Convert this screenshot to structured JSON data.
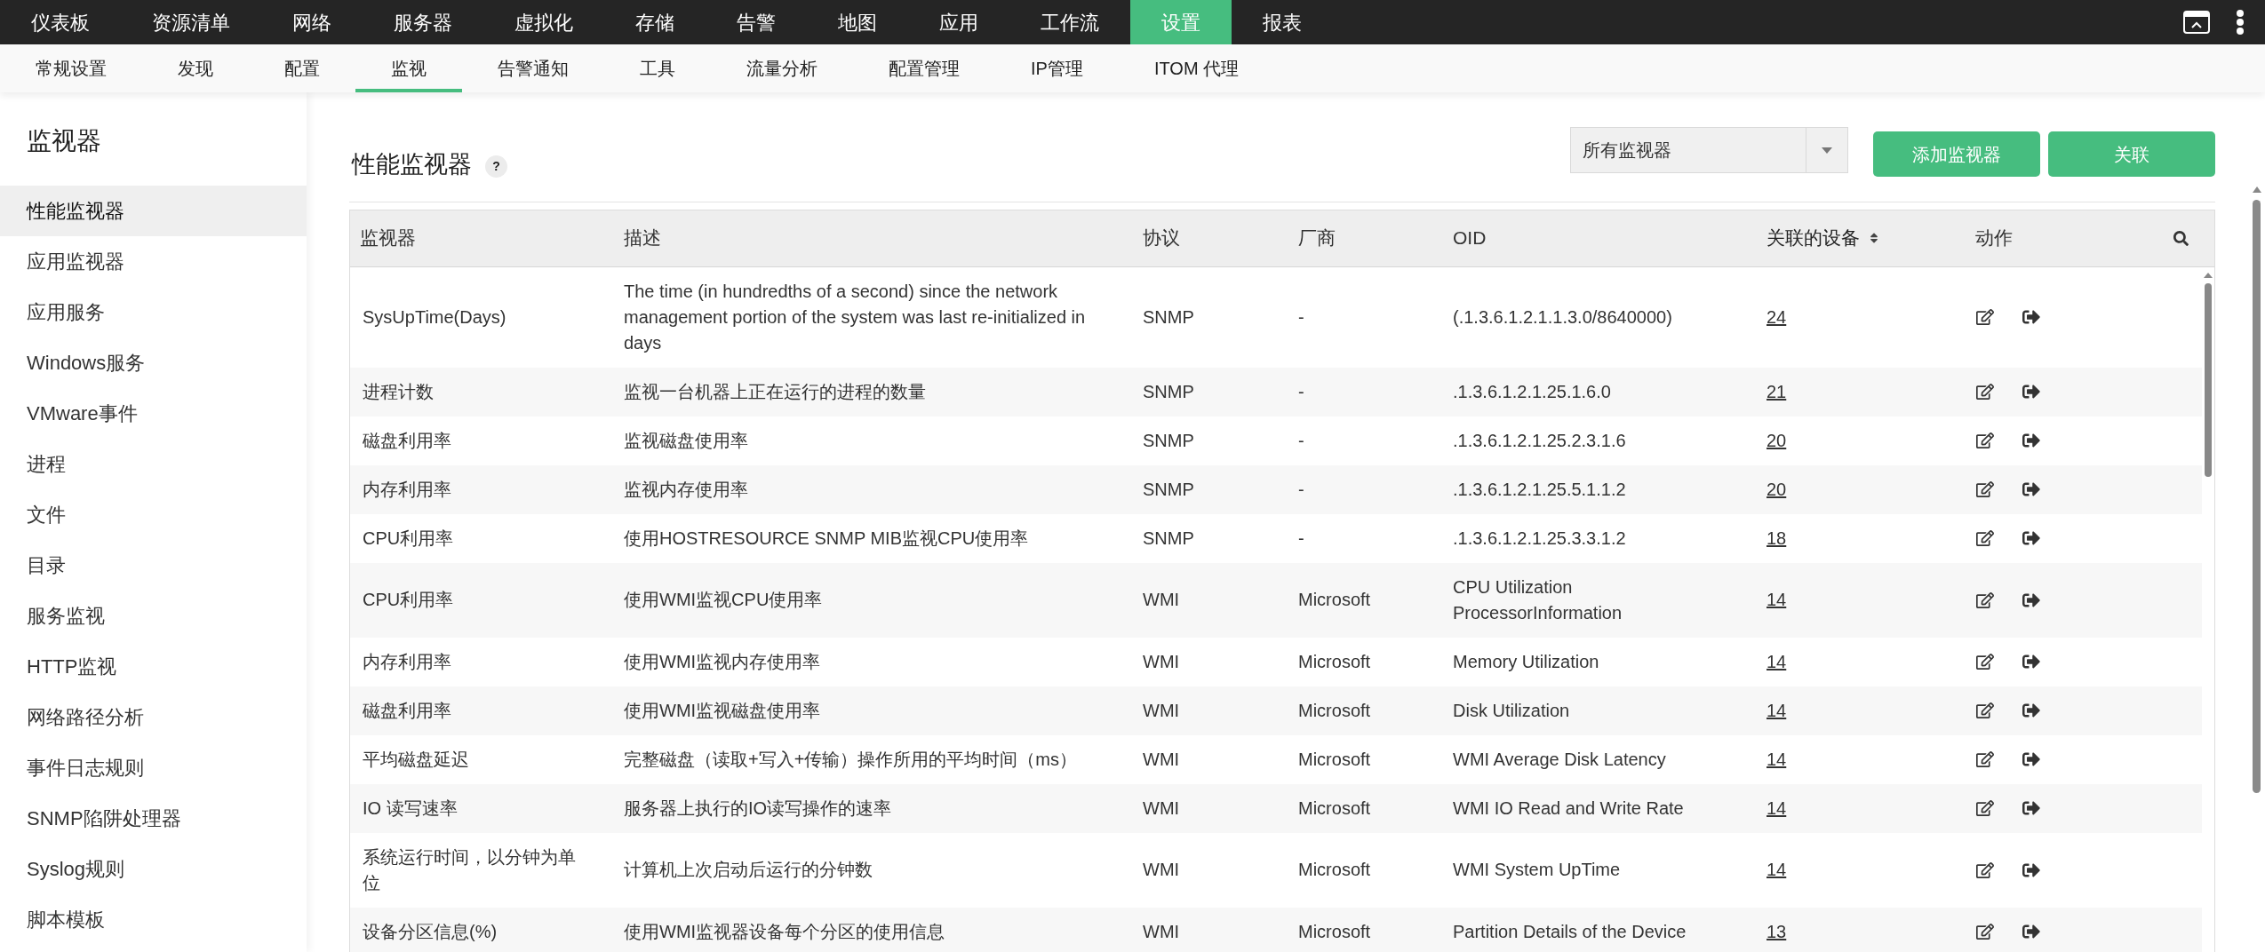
{
  "top_nav": [
    {
      "label": "仪表板",
      "selected": false
    },
    {
      "label": "资源清单",
      "selected": false
    },
    {
      "label": "网络",
      "selected": false
    },
    {
      "label": "服务器",
      "selected": false
    },
    {
      "label": "虚拟化",
      "selected": false
    },
    {
      "label": "存储",
      "selected": false
    },
    {
      "label": "告警",
      "selected": false
    },
    {
      "label": "地图",
      "selected": false
    },
    {
      "label": "应用",
      "selected": false
    },
    {
      "label": "工作流",
      "selected": false
    },
    {
      "label": "设置",
      "selected": true
    },
    {
      "label": "报表",
      "selected": false
    }
  ],
  "sub_nav": [
    {
      "label": "常规设置",
      "selected": false
    },
    {
      "label": "发现",
      "selected": false
    },
    {
      "label": "配置",
      "selected": false
    },
    {
      "label": "监视",
      "selected": true
    },
    {
      "label": "告警通知",
      "selected": false
    },
    {
      "label": "工具",
      "selected": false
    },
    {
      "label": "流量分析",
      "selected": false
    },
    {
      "label": "配置管理",
      "selected": false
    },
    {
      "label": "IP管理",
      "selected": false
    },
    {
      "label": "ITOM 代理",
      "selected": false
    }
  ],
  "sidebar": {
    "title": "监视器",
    "items": [
      {
        "label": "性能监视器",
        "selected": true
      },
      {
        "label": "应用监视器",
        "selected": false
      },
      {
        "label": "应用服务",
        "selected": false
      },
      {
        "label": "Windows服务",
        "selected": false
      },
      {
        "label": "VMware事件",
        "selected": false
      },
      {
        "label": "进程",
        "selected": false
      },
      {
        "label": "文件",
        "selected": false
      },
      {
        "label": "目录",
        "selected": false
      },
      {
        "label": "服务监视",
        "selected": false
      },
      {
        "label": "HTTP监视",
        "selected": false
      },
      {
        "label": "网络路径分析",
        "selected": false
      },
      {
        "label": "事件日志规则",
        "selected": false
      },
      {
        "label": "SNMP陷阱处理器",
        "selected": false
      },
      {
        "label": "Syslog规则",
        "selected": false
      },
      {
        "label": "脚本模板",
        "selected": false
      }
    ]
  },
  "main": {
    "title": "性能监视器",
    "help": "?",
    "filter": {
      "value": "所有监视器"
    },
    "buttons": [
      {
        "label": "添加监视器"
      },
      {
        "label": "关联"
      }
    ]
  },
  "table": {
    "columns": [
      {
        "label": "监视器",
        "sortable": false
      },
      {
        "label": "描述",
        "sortable": false
      },
      {
        "label": "协议",
        "sortable": false
      },
      {
        "label": "厂商",
        "sortable": false
      },
      {
        "label": "OID",
        "sortable": false
      },
      {
        "label": "关联的设备",
        "sortable": true
      },
      {
        "label": "动作",
        "sortable": false
      }
    ],
    "rows": [
      {
        "monitor": "SysUpTime(Days)",
        "description": "The time (in hundredths of a second) since the network management portion of the system was last re-initialized in days",
        "protocol": "SNMP",
        "vendor": "-",
        "oid": "(.1.3.6.1.2.1.1.3.0/8640000)",
        "devices": "24"
      },
      {
        "monitor": "进程计数",
        "description": "监视一台机器上正在运行的进程的数量",
        "protocol": "SNMP",
        "vendor": "-",
        "oid": ".1.3.6.1.2.1.25.1.6.0",
        "devices": "21"
      },
      {
        "monitor": "磁盘利用率",
        "description": "监视磁盘使用率",
        "protocol": "SNMP",
        "vendor": "-",
        "oid": ".1.3.6.1.2.1.25.2.3.1.6",
        "devices": "20"
      },
      {
        "monitor": "内存利用率",
        "description": "监视内存使用率",
        "protocol": "SNMP",
        "vendor": "-",
        "oid": ".1.3.6.1.2.1.25.5.1.1.2",
        "devices": "20"
      },
      {
        "monitor": "CPU利用率",
        "description": "使用HOSTRESOURCE SNMP MIB监视CPU使用率",
        "protocol": "SNMP",
        "vendor": "-",
        "oid": ".1.3.6.1.2.1.25.3.3.1.2",
        "devices": "18"
      },
      {
        "monitor": "CPU利用率",
        "description": "使用WMI监视CPU使用率",
        "protocol": "WMI",
        "vendor": "Microsoft",
        "oid": "CPU Utilization ProcessorInformation",
        "devices": "14"
      },
      {
        "monitor": "内存利用率",
        "description": "使用WMI监视内存使用率",
        "protocol": "WMI",
        "vendor": "Microsoft",
        "oid": "Memory Utilization",
        "devices": "14"
      },
      {
        "monitor": "磁盘利用率",
        "description": "使用WMI监视磁盘使用率",
        "protocol": "WMI",
        "vendor": "Microsoft",
        "oid": "Disk Utilization",
        "devices": "14"
      },
      {
        "monitor": "平均磁盘延迟",
        "description": "完整磁盘（读取+写入+传输）操作所用的平均时间（ms）",
        "protocol": "WMI",
        "vendor": "Microsoft",
        "oid": "WMI Average Disk Latency",
        "devices": "14"
      },
      {
        "monitor": "IO 读写速率",
        "description": "服务器上执行的IO读写操作的速率",
        "protocol": "WMI",
        "vendor": "Microsoft",
        "oid": "WMI IO Read and Write Rate",
        "devices": "14"
      },
      {
        "monitor": "系统运行时间，以分钟为单位",
        "description": "计算机上次启动后运行的分钟数",
        "protocol": "WMI",
        "vendor": "Microsoft",
        "oid": "WMI System UpTime",
        "devices": "14"
      },
      {
        "monitor": "设备分区信息(%)",
        "description": "使用WMI监视器设备每个分区的使用信息",
        "protocol": "WMI",
        "vendor": "Microsoft",
        "oid": "Partition Details of the Device",
        "devices": "13"
      }
    ]
  }
}
